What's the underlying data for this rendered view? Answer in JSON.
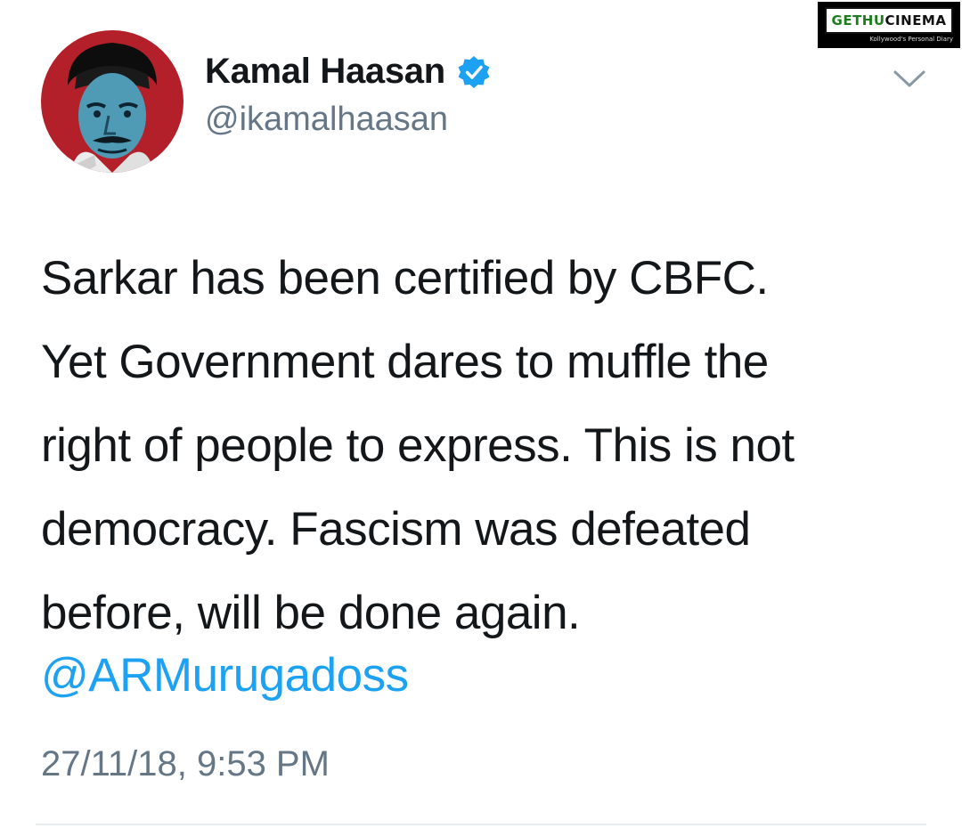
{
  "watermark": {
    "brand_part1": "GETHU",
    "brand_part2": "CINEMA",
    "tagline": "Kollywood's Personal Diary"
  },
  "tweet": {
    "author_name": "Kamal Haasan",
    "handle": "@ikamalhaasan",
    "verified": true,
    "text_lines": [
      "Sarkar has been certified by CBFC.",
      "Yet Government dares to muffle the",
      "right of people to express. This is not",
      "democracy. Fascism was defeated",
      "before, will be done again."
    ],
    "mention": "@ARMurugadoss",
    "timestamp": "27/11/18, 9:53 PM"
  },
  "colors": {
    "text": "#14171a",
    "secondary": "#657786",
    "link": "#1da1f2",
    "verified_badge": "#1da1f2",
    "avatar_bg": "#b3202a",
    "watermark_green": "#1e7d1e"
  },
  "icons": {
    "verified": "verified-badge-icon",
    "menu": "chevron-down-icon"
  }
}
